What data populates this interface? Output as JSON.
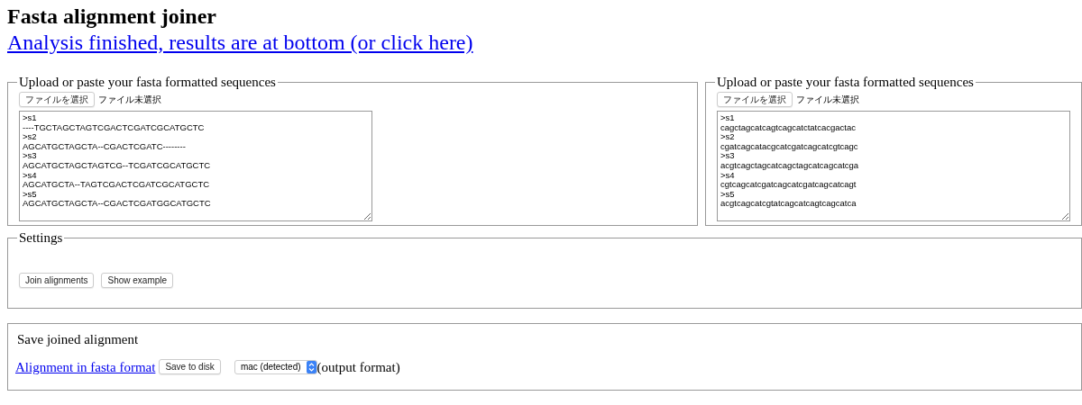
{
  "title": "Fasta alignment joiner",
  "status_link": "Analysis finished, results are at bottom (or click here)",
  "panels": [
    {
      "legend": "Upload or paste your fasta formatted sequences",
      "file_button": "ファイルを選択",
      "file_status": "ファイル未選択",
      "lines": [
        ">s1",
        "----TGCTAGCTAGTCGACTCGATCGCATGCTC",
        ">s2",
        "AGCATGCTAGCTA--CGACTCGATC--------",
        ">s3",
        "AGCATGCTAGCTAGTCG--TCGATCGCATGCTC",
        ">s4",
        "AGCATGCTA--TAGTCGACTCGATCGCATGCTC",
        ">s5",
        "AGCATGCTAGCTA--CGACTCGATGGCATGCTC"
      ]
    },
    {
      "legend": "Upload or paste your fasta formatted sequences",
      "file_button": "ファイルを選択",
      "file_status": "ファイル未選択",
      "lines": [
        ">s1",
        "cagctagcatcagtcagcatctatcacgactac",
        ">s2",
        "cgatcagcatacgcatcgatcagcatcgtcagc",
        ">s3",
        "acgtcagctagcatcagctagcatcagcatcga",
        ">s4",
        "cgtcagcatcgatcagcatcgatcagcatcagt",
        ">s5",
        "acgtcagcatcgtatcagcatcagtcagcatca"
      ]
    }
  ],
  "settings": {
    "legend": "Settings",
    "buttons": [
      "Join alignments",
      "Show example"
    ]
  },
  "save": {
    "heading": "Save joined alignment",
    "link": "Alignment in fasta format",
    "button": "Save to disk",
    "format": "mac (detected)",
    "note": "(output format)"
  }
}
